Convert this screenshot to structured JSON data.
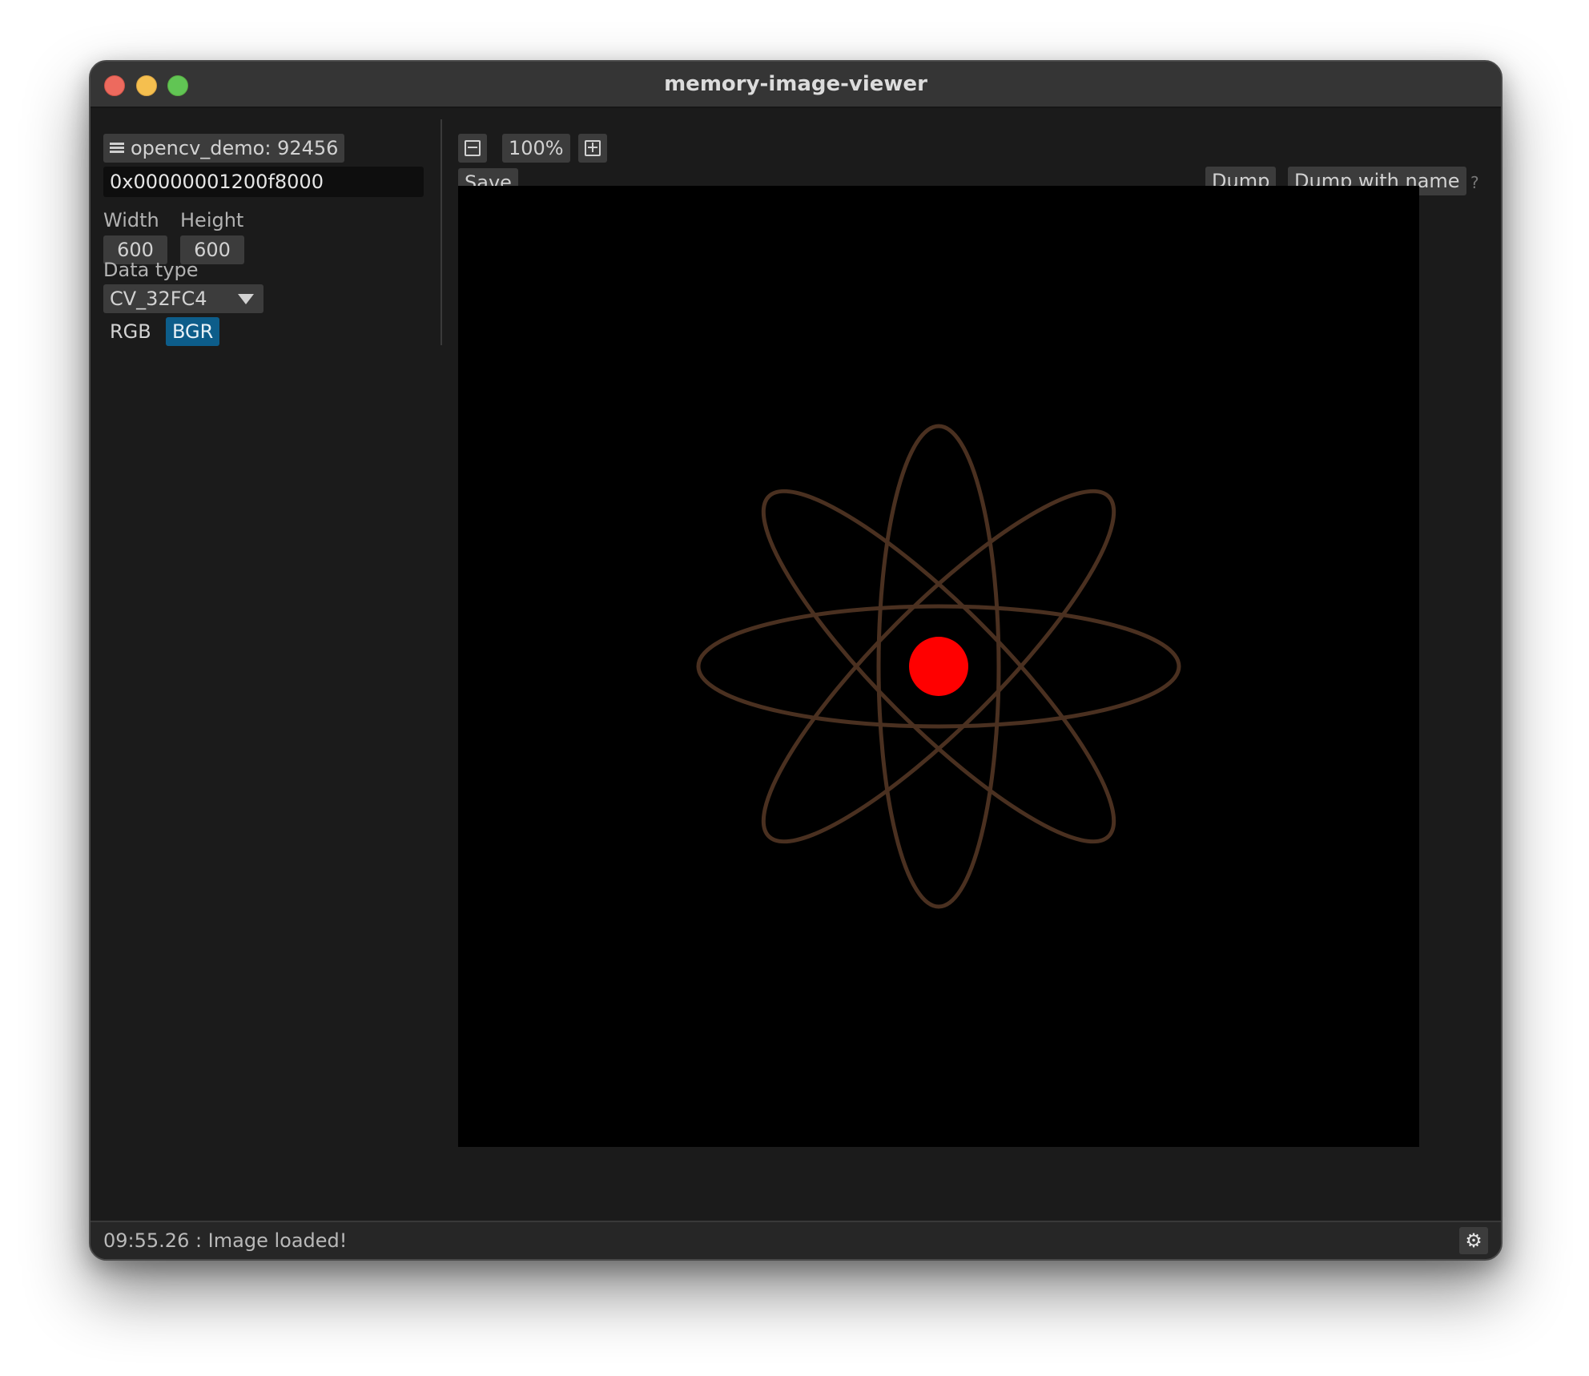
{
  "window": {
    "title": "memory-image-viewer"
  },
  "sidebar": {
    "process_label": "opencv_demo: 92456",
    "address": "0x00000001200f8000",
    "width_label": "Width",
    "height_label": "Height",
    "width_value": "600",
    "height_value": "600",
    "data_type_label": "Data type",
    "data_type_value": "CV_32FC4",
    "channel_order": {
      "rgb_label": "RGB",
      "bgr_label": "BGR",
      "selected": "BGR"
    }
  },
  "toolbar": {
    "zoom_out_icon": "zoom-out-icon",
    "zoom_level": "100%",
    "zoom_in_icon": "zoom-in-icon",
    "save_label": "Save",
    "dump_label": "Dump",
    "dump_with_name_label": "Dump with name",
    "help_label": "?"
  },
  "canvas": {
    "image": {
      "description_icon": "atom",
      "background_color": "#000000",
      "orbit_color": "#4a3020",
      "nucleus_color": "#ff0000"
    }
  },
  "statusbar": {
    "message": "09:55.26 : Image loaded!",
    "settings_icon": "gear-icon"
  },
  "colors": {
    "window_bg": "#1b1b1b",
    "titlebar_bg": "#353535",
    "button_bg": "#3c3c3c",
    "selected_toggle": "#0d5d8a",
    "close": "#ed6a5e",
    "minimize": "#f5bf4f",
    "maximize": "#61c554"
  }
}
